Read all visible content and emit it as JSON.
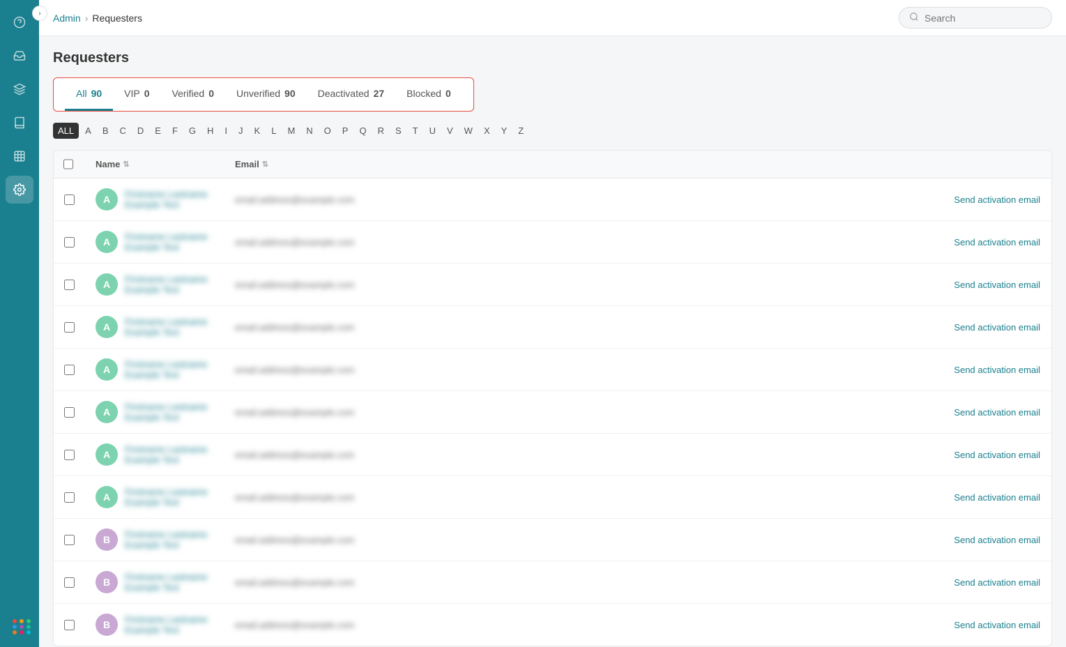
{
  "sidebar": {
    "toggle_icon": "›",
    "icons": [
      {
        "name": "help-icon",
        "symbol": "?",
        "active": false
      },
      {
        "name": "inbox-icon",
        "symbol": "✉",
        "active": false
      },
      {
        "name": "layers-icon",
        "symbol": "⊞",
        "active": false
      },
      {
        "name": "book-icon",
        "symbol": "☰",
        "active": false
      },
      {
        "name": "chart-icon",
        "symbol": "▦",
        "active": false
      },
      {
        "name": "settings-icon",
        "symbol": "⚙",
        "active": true
      }
    ],
    "dot_colors": [
      "#e74c3c",
      "#f39c12",
      "#2ecc71",
      "#3498db",
      "#9b59b6",
      "#1abc9c",
      "#e67e22",
      "#e91e63",
      "#00bcd4"
    ]
  },
  "header": {
    "breadcrumb_admin": "Admin",
    "breadcrumb_sep": "›",
    "breadcrumb_current": "Requesters",
    "search_placeholder": "Search"
  },
  "page": {
    "title": "Requesters"
  },
  "filter_tabs": [
    {
      "id": "all",
      "label": "All",
      "count": "90",
      "active": true
    },
    {
      "id": "vip",
      "label": "VIP",
      "count": "0",
      "active": false
    },
    {
      "id": "verified",
      "label": "Verified",
      "count": "0",
      "active": false
    },
    {
      "id": "unverified",
      "label": "Unverified",
      "count": "90",
      "active": false
    },
    {
      "id": "deactivated",
      "label": "Deactivated",
      "count": "27",
      "active": false
    },
    {
      "id": "blocked",
      "label": "Blocked",
      "count": "0",
      "active": false
    }
  ],
  "alphabet": [
    "ALL",
    "A",
    "B",
    "C",
    "D",
    "E",
    "F",
    "G",
    "H",
    "I",
    "J",
    "K",
    "L",
    "M",
    "N",
    "O",
    "P",
    "Q",
    "R",
    "S",
    "T",
    "U",
    "V",
    "W",
    "X",
    "Y",
    "Z"
  ],
  "table": {
    "columns": [
      {
        "label": "Name",
        "sortable": true
      },
      {
        "label": "Email",
        "sortable": true
      },
      {
        "label": ""
      }
    ],
    "rows": [
      {
        "id": 1,
        "avatar_letter": "A",
        "avatar_color": "green",
        "name": "blurred-name-1",
        "email": "blurred-email-1@example.com",
        "action": "Send activation email"
      },
      {
        "id": 2,
        "avatar_letter": "A",
        "avatar_color": "green",
        "name": "blurred-name-2",
        "email": "blurred-email-2@example.com",
        "action": "Send activation email"
      },
      {
        "id": 3,
        "avatar_letter": "A",
        "avatar_color": "green",
        "name": "blurred-name-3",
        "email": "blurred-email-3@example.com",
        "action": "Send activation email"
      },
      {
        "id": 4,
        "avatar_letter": "A",
        "avatar_color": "green",
        "name": "blurred-name-4",
        "email": "blurred-email-4@example.com",
        "action": "Send activation email"
      },
      {
        "id": 5,
        "avatar_letter": "A",
        "avatar_color": "green",
        "name": "blurred-name-5",
        "email": "blurred-email-5@example.com",
        "action": "Send activation email"
      },
      {
        "id": 6,
        "avatar_letter": "A",
        "avatar_color": "green",
        "name": "blurred-name-6",
        "email": "blurred-email-6@example.com",
        "action": "Send activation email"
      },
      {
        "id": 7,
        "avatar_letter": "A",
        "avatar_color": "green",
        "name": "blurred-name-7",
        "email": "blurred-email-7@example.com",
        "action": "Send activation email"
      },
      {
        "id": 8,
        "avatar_letter": "A",
        "avatar_color": "green",
        "name": "blurred-name-8",
        "email": "blurred-email-8@example.com",
        "action": "Send activation email"
      },
      {
        "id": 9,
        "avatar_letter": "B",
        "avatar_color": "purple",
        "name": "blurred-name-9",
        "email": "blurred-email-9@example.com",
        "action": "Send activation email"
      },
      {
        "id": 10,
        "avatar_letter": "B",
        "avatar_color": "purple",
        "name": "blurred-name-10",
        "email": "blurred-email-10@example.com",
        "action": "Send activation email"
      },
      {
        "id": 11,
        "avatar_letter": "B",
        "avatar_color": "purple",
        "name": "blurred-name-11",
        "email": "blurred-email-11@example.com",
        "action": "Send activation email"
      }
    ],
    "send_activation_label": "Send activation email"
  }
}
